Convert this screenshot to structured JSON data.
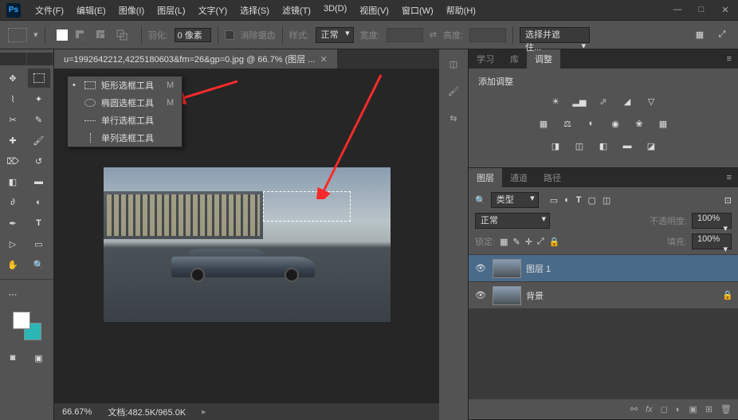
{
  "menubar": [
    "文件(F)",
    "编辑(E)",
    "图像(I)",
    "图层(L)",
    "文字(Y)",
    "选择(S)",
    "滤镜(T)",
    "3D(D)",
    "视图(V)",
    "窗口(W)",
    "帮助(H)"
  ],
  "options": {
    "feather_label": "羽化:",
    "feather_value": "0 像素",
    "antialias": "消除锯齿",
    "style_label": "样式:",
    "style_value": "正常",
    "width_label": "宽度:",
    "height_label": "高度:",
    "refine": "选择并遮住..."
  },
  "doc": {
    "tab": "u=1992642212,4225180603&fm=26&gp=0.jpg @ 66.7% (图层 ..."
  },
  "flyout": [
    {
      "mark": "•",
      "label": "矩形选框工具",
      "key": "M"
    },
    {
      "mark": "",
      "label": "椭圆选框工具",
      "key": "M"
    },
    {
      "mark": "",
      "label": "单行选框工具",
      "key": ""
    },
    {
      "mark": "",
      "label": "单列选框工具",
      "key": ""
    }
  ],
  "adjust_panel": {
    "tabs": [
      "学习",
      "库",
      "调整"
    ],
    "title": "添加调整"
  },
  "layers_panel": {
    "tabs": [
      "图层",
      "通道",
      "路径"
    ],
    "filter": "类型",
    "blend": "正常",
    "opacity_label": "不透明度:",
    "opacity_value": "100%",
    "lock_label": "锁定:",
    "fill_label": "填充:",
    "fill_value": "100%",
    "layers": [
      {
        "name": "图层 1",
        "selected": true,
        "locked": false
      },
      {
        "name": "背景",
        "selected": false,
        "locked": true
      }
    ]
  },
  "status": {
    "zoom": "66.67%",
    "doc_label": "文档:",
    "doc_size": "482.5K/965.0K"
  }
}
